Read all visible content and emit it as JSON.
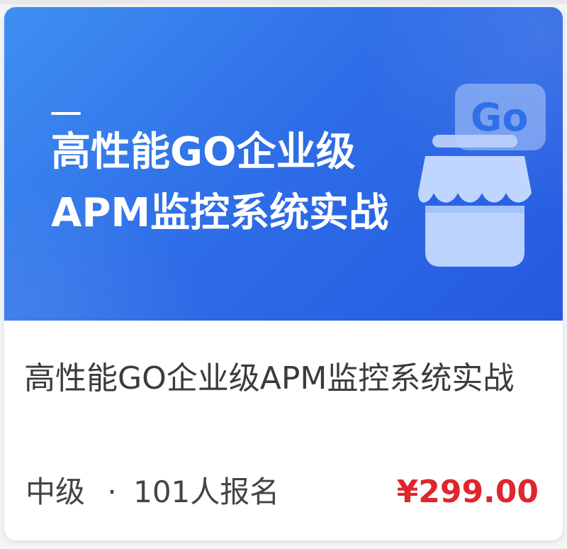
{
  "banner": {
    "title_line1": "高性能GO企业级",
    "title_line2": "APM监控系统实战",
    "badge_text": "Go",
    "icon": "store-icon"
  },
  "course": {
    "title": "高性能GO企业级APM监控系统实战",
    "level": "中级",
    "separator": "·",
    "enrolled": "101人报名",
    "price": "¥299.00"
  },
  "colors": {
    "banner_start": "#3f8ff2",
    "banner_end": "#2559e0",
    "price": "#e0252d",
    "text": "#3b3b3b"
  }
}
